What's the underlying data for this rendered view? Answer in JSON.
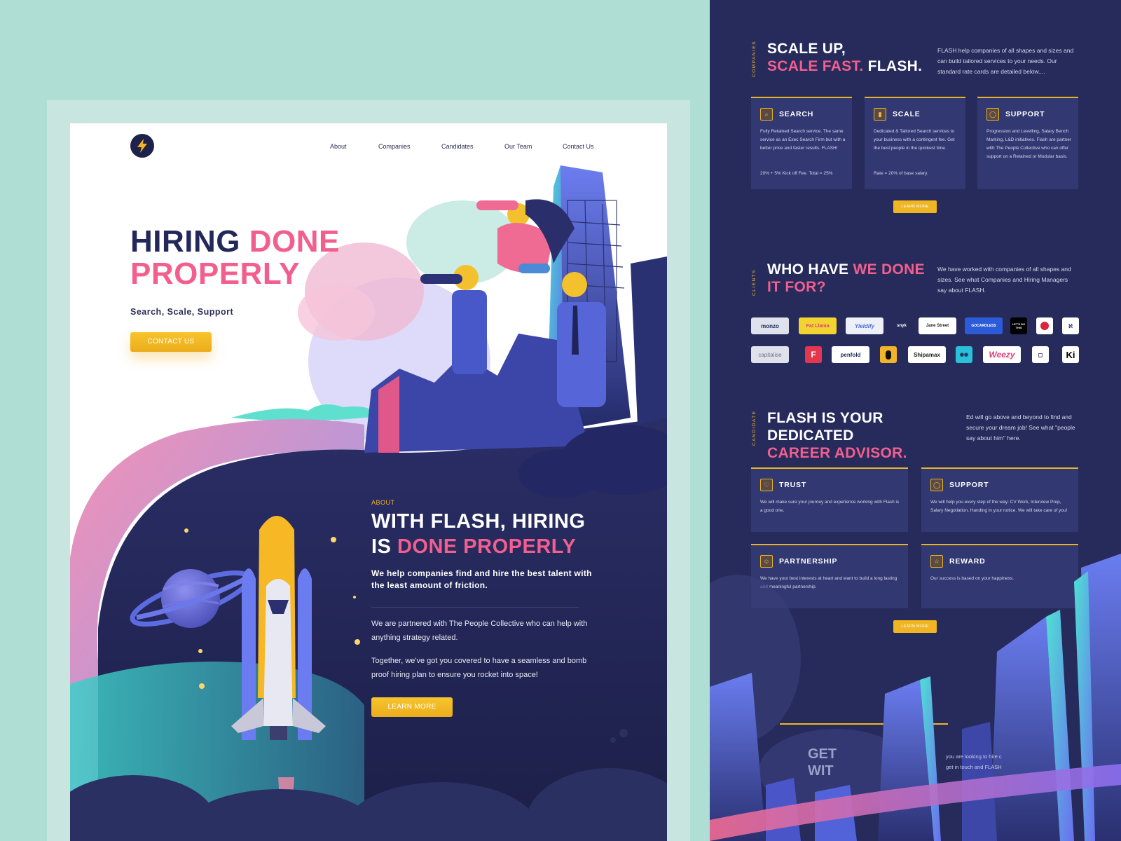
{
  "left": {
    "nav": [
      "About",
      "Companies",
      "Candidates",
      "Our Team",
      "Contact Us"
    ],
    "hero": {
      "title_line1_a": "HIRING",
      "title_line1_b": "DONE",
      "title_line2": "PROPERLY",
      "subtitle": "Search, Scale, Support",
      "button": "CONTACT US"
    },
    "about": {
      "label": "ABOUT",
      "title_line1": "WITH FLASH, HIRING",
      "title_line2_a": "IS",
      "title_line2_b": "DONE PROPERLY",
      "lead": "We help companies find and hire the best talent with the least amount of friction.",
      "p1": "We are partnered with The People Collective who can help with anything strategy related.",
      "p2": "Together, we've got you covered to have a seamless and bomb proof hiring plan to ensure you rocket into space!",
      "button": "LEARN MORE"
    }
  },
  "right": {
    "companies": {
      "vlabel": "COMPANIES",
      "title_line1": "SCALE UP,",
      "title_line2_a": "SCALE FAST.",
      "title_line2_b": "FLASH.",
      "desc": "FLASH help companies of all shapes and sizes and can build tailored services to your needs. Our standard rate cards are detailed below....",
      "cards": [
        {
          "title": "SEARCH",
          "icon": "search-icon",
          "glyph": "⌕",
          "body": "Fully Retained Search service. The same service as an Exec Search Firm but with a better price and faster results. FLASH!",
          "foot": "20% + 5% Kick off Fee. Total = 25%"
        },
        {
          "title": "SCALE",
          "icon": "bar-chart-icon",
          "glyph": "▮",
          "body": "Dedicated & Tailored Search services to your business with a contingent fee. Get the best people in the quickest time.",
          "foot": "Rate = 20% of base salary."
        },
        {
          "title": "SUPPORT",
          "icon": "chat-bubble-icon",
          "glyph": "◯",
          "body": "Progression and Levelling, Salary Bench Marking, L&D initiatives. Flash are partner with The People Collective who can offer support on a Retained or Modular basis.",
          "foot": ""
        }
      ],
      "button": "LEARN MORE"
    },
    "clients": {
      "vlabel": "CLIENTS",
      "title_line1_a": "WHO HAVE",
      "title_line1_b": "WE DONE",
      "title_line2": "IT FOR?",
      "desc": "We have worked with companies of all shapes and sizes. See what Companies and Hiring Managers say about FLASH.",
      "row1": [
        "monzo",
        "Fat Llama",
        "Yieldify",
        "snyk",
        "Jane Street",
        "GOCARDLESS",
        "LET'S DO THIS",
        "",
        "ℵ"
      ],
      "row2": [
        "capitalise",
        "F",
        "penfold",
        "",
        "Shipamax",
        "◉◉",
        "Weezy",
        "◻",
        "Ki"
      ],
      "colors": {
        "monzo": "#dfe2ec",
        "fatllama": "#f2d431",
        "gocardless": "#2b5bd7",
        "weezy": "#ffffff"
      }
    },
    "candidate": {
      "vlabel": "CANDIDATE",
      "title_line1": "FLASH IS YOUR",
      "title_line2": "DEDICATED",
      "title_line3": "CAREER ADVISOR.",
      "desc": "Ed will go above and beyond to find and secure your dream job! See what \"people say about him\" here.",
      "cards": [
        {
          "title": "TRUST",
          "icon": "heart-icon",
          "glyph": "♡",
          "body": "We will make sure your journey and experience working with Flash is a good one."
        },
        {
          "title": "SUPPORT",
          "icon": "chat-bubble-icon",
          "glyph": "◯",
          "body": "We will help you every step of the way: CV Work, Interview Prep, Salary Negotiation, Handing in your notice. We will take care of you!"
        },
        {
          "title": "PARTNERSHIP",
          "icon": "people-icon",
          "glyph": "☺",
          "body": "We have your best interests at heart and want to build a long lasting and meaningful partnership."
        },
        {
          "title": "REWARD",
          "icon": "star-icon",
          "glyph": "☆",
          "body": "Our success is based on your happiness."
        }
      ],
      "button": "LEARN MORE"
    },
    "footer": {
      "title_line1": "GET",
      "title_line2": "WIT",
      "desc_line1": "you are looking to hire c",
      "desc_line2": "get in touch and FLASH"
    }
  },
  "colors": {
    "navy": "#23285a",
    "pink": "#f25f8e",
    "gold": "#f0b523",
    "mint": "#afded4",
    "panel": "#262b5c"
  }
}
